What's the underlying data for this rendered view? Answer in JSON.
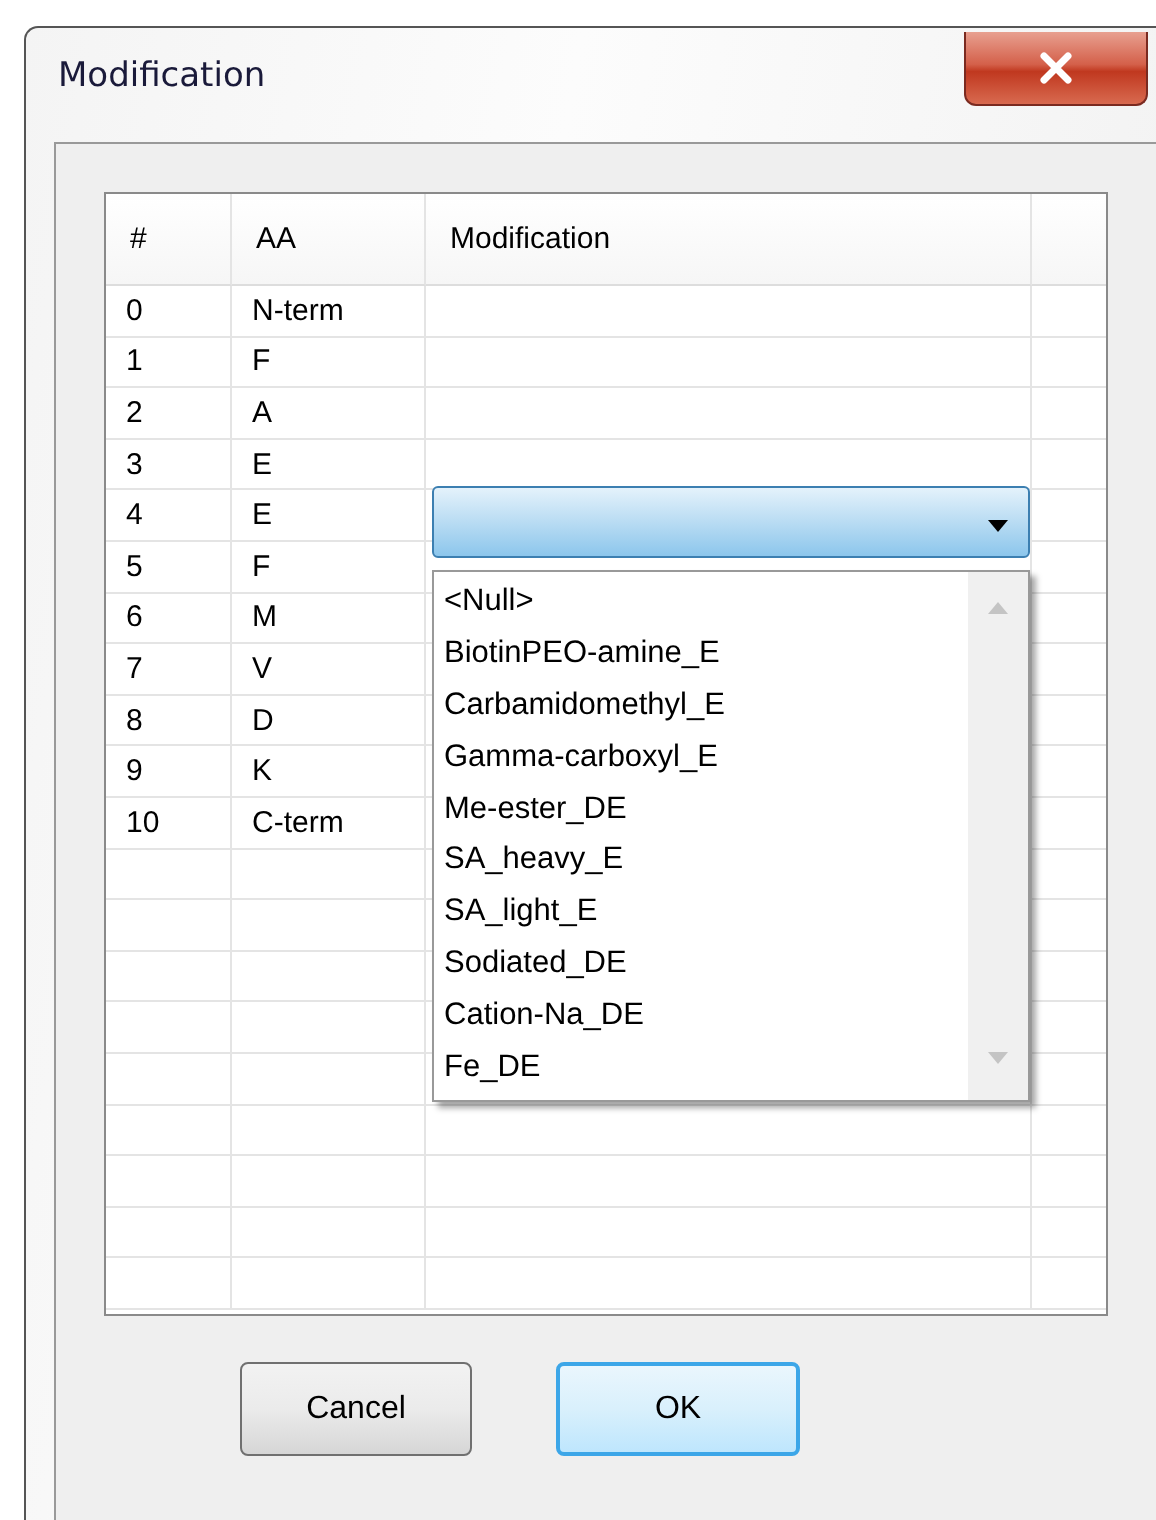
{
  "window": {
    "title": "Modification"
  },
  "table": {
    "columns": [
      "#",
      "AA",
      "Modification"
    ],
    "rows": [
      {
        "index": "0",
        "aa": "N-term",
        "editing": false
      },
      {
        "index": "1",
        "aa": "F",
        "editing": false
      },
      {
        "index": "2",
        "aa": "A",
        "editing": false
      },
      {
        "index": "3",
        "aa": "E",
        "editing": false
      },
      {
        "index": "4",
        "aa": "E",
        "editing": true
      },
      {
        "index": "5",
        "aa": "F",
        "editing": false
      },
      {
        "index": "6",
        "aa": "M",
        "editing": false
      },
      {
        "index": "7",
        "aa": "V",
        "editing": false
      },
      {
        "index": "8",
        "aa": "D",
        "editing": false
      },
      {
        "index": "9",
        "aa": "K",
        "editing": false
      },
      {
        "index": "10",
        "aa": "C-term",
        "editing": false
      }
    ]
  },
  "dropdown": {
    "options": [
      "<Null>",
      "BiotinPEO-amine_E",
      "Carbamidomethyl_E",
      "Gamma-carboxyl_E",
      "Me-ester_DE",
      "SA_heavy_E",
      "SA_light_E",
      "Sodiated_DE",
      "Cation-Na_DE",
      "Fe_DE"
    ]
  },
  "buttons": [
    {
      "label": "Cancel",
      "default": false
    },
    {
      "label": "OK",
      "default": true
    }
  ]
}
